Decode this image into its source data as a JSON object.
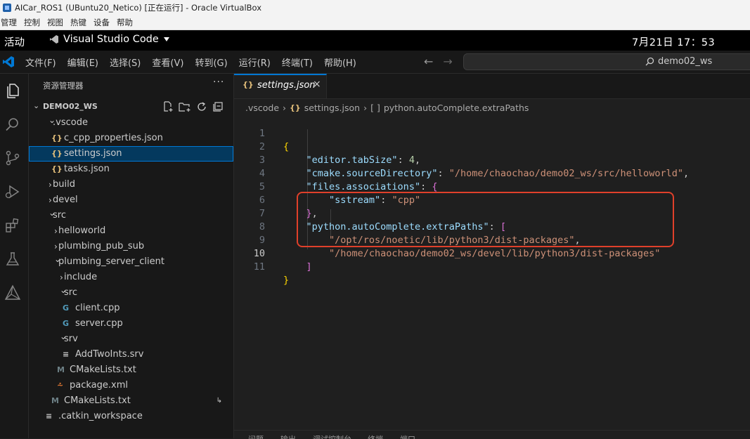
{
  "vbox": {
    "title": "AICar_ROS1 (UBuntu20_Netico) [正在运行] - Oracle VirtualBox",
    "menu": [
      "管理",
      "控制",
      "视图",
      "热键",
      "设备",
      "帮助"
    ]
  },
  "gnome": {
    "activities": "活动",
    "app_name": "Visual Studio Code",
    "app_menu_icon": "caret-down-icon",
    "clock": "7月21日  17：53"
  },
  "vscode": {
    "menu": [
      "文件(F)",
      "编辑(E)",
      "选择(S)",
      "查看(V)",
      "转到(G)",
      "运行(R)",
      "终端(T)",
      "帮助(H)"
    ],
    "search": "demo02_ws",
    "accent": "#0078d4"
  },
  "explorer": {
    "title": "资源管理器",
    "more": "···",
    "workspace": "DEMO02_WS",
    "tree": [
      {
        "label": ".vscode",
        "type": "folder",
        "expanded": true
      },
      {
        "label": "c_cpp_properties.json",
        "type": "json"
      },
      {
        "label": "settings.json",
        "type": "json",
        "selected": true
      },
      {
        "label": "tasks.json",
        "type": "json"
      },
      {
        "label": "build",
        "type": "folder",
        "expanded": false
      },
      {
        "label": "devel",
        "type": "folder",
        "expanded": false
      },
      {
        "label": "src",
        "type": "folder",
        "expanded": true
      },
      {
        "label": "helloworld",
        "type": "folder",
        "expanded": false
      },
      {
        "label": "plumbing_pub_sub",
        "type": "folder",
        "expanded": false
      },
      {
        "label": "plumbing_server_client",
        "type": "folder",
        "expanded": true
      },
      {
        "label": "include",
        "type": "folder",
        "expanded": false
      },
      {
        "label": "src",
        "type": "folder",
        "expanded": true
      },
      {
        "label": "client.cpp",
        "type": "cpp"
      },
      {
        "label": "server.cpp",
        "type": "cpp"
      },
      {
        "label": "srv",
        "type": "folder",
        "expanded": true
      },
      {
        "label": "AddTwoInts.srv",
        "type": "srv"
      },
      {
        "label": "CMakeLists.txt",
        "type": "cmake"
      },
      {
        "label": "package.xml",
        "type": "xml"
      },
      {
        "label": "CMakeLists.txt",
        "type": "cmake",
        "aux": "↳"
      },
      {
        "label": ".catkin_workspace",
        "type": "plain"
      }
    ]
  },
  "editor": {
    "tab": {
      "icon": "{}",
      "label": "settings.json",
      "close": "×"
    },
    "breadcrumb": [
      ".vscode",
      "settings.json",
      "python.autoComplete.extraPaths"
    ],
    "line_numbers": [
      "1",
      "2",
      "3",
      "4",
      "5",
      "6",
      "7",
      "8",
      "9",
      "10",
      "11"
    ],
    "active_line": "10",
    "code": {
      "l1_open": "{",
      "tabsize_key": "\"editor.tabSize\"",
      "tabsize_val": "4",
      "cmake_key": "\"cmake.sourceDirectory\"",
      "cmake_val": "\"/home/chaochao/demo02_ws/src/helloworld\"",
      "assoc_key": "\"files.associations\"",
      "assoc_open": "{",
      "sstream_key": "\"sstream\"",
      "sstream_val": "\"cpp\"",
      "assoc_close": "}",
      "extra_key": "\"python.autoComplete.extraPaths\"",
      "extra_open": "[",
      "path1": "\"/opt/ros/noetic/lib/python3/dist-packages\"",
      "path2": "\"/home/chaochao/demo02_ws/devel/lib/python3/dist-packages\"",
      "extra_close": "]",
      "l11_close": "}"
    },
    "highlight_color": "#e0402a"
  },
  "panel": {
    "tabs": [
      "问题",
      "输出",
      "调试控制台",
      "终端",
      "端口"
    ]
  }
}
